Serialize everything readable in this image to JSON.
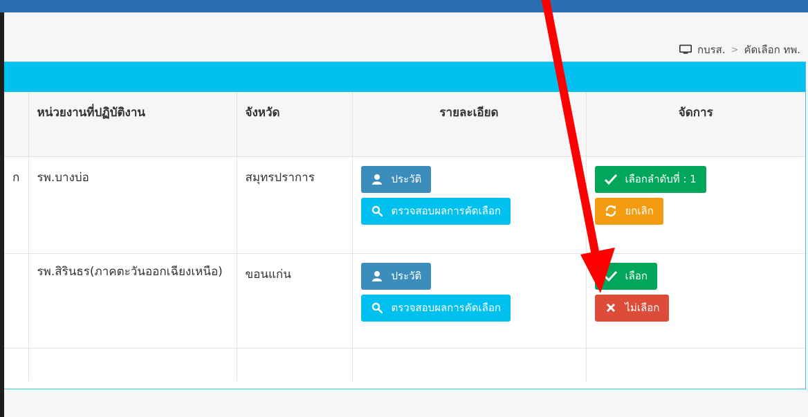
{
  "breadcrumb": {
    "home": "กบรส.",
    "separator": ">",
    "current": "คัดเลือก ทพ."
  },
  "table": {
    "headers": {
      "unit": "หน่วยงานที่ปฏิบัติงาน",
      "province": "จังหวัด",
      "detail": "รายละเอียด",
      "manage": "จัดการ"
    },
    "rows": [
      {
        "lead": "ก",
        "unit": "รพ.บางบ่อ",
        "province": "สมุทรปราการ",
        "history_label": "ประวัติ",
        "check_label": "ตรวจสอบผลการคัดเลือก",
        "primary_label": "เลือกลำดับที่ : 1",
        "secondary_label": "ยกเลิก"
      },
      {
        "lead": "",
        "unit": "รพ.สิรินธร(ภาคตะวันออกเฉียงเหนือ)",
        "province": "ขอนแก่น",
        "history_label": "ประวัติ",
        "check_label": "ตรวจสอบผลการคัดเลือก",
        "primary_label": "เลือก",
        "secondary_label": "ไม่เลือก"
      }
    ]
  },
  "colors": {
    "header_bar": "#00c0ef",
    "history_button": "#3c8dbc",
    "check_button": "#00c0ef",
    "select_button": "#00a65a",
    "cancel_button": "#f39c12",
    "reject_button": "#dd4b39",
    "annotation_arrow": "#ff0000"
  },
  "icons": {
    "breadcrumb": "monitor-icon",
    "history": "user-icon",
    "check": "search-icon",
    "select": "check-icon",
    "cancel": "refresh-icon",
    "reject": "close-icon"
  }
}
